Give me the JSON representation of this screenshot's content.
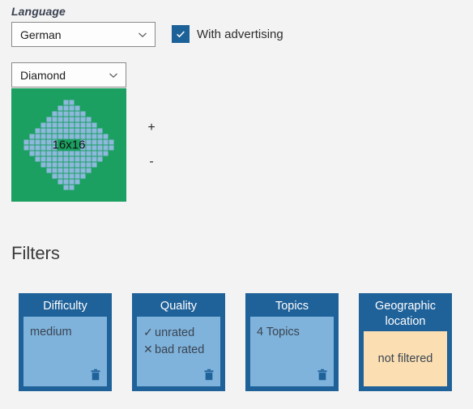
{
  "language_section": {
    "label": "Language",
    "dropdown": {
      "value": "German",
      "icon": "chevron-down-icon"
    },
    "advertising_checkbox": {
      "label": "With advertising",
      "checked": true,
      "icon": "checkmark-icon"
    }
  },
  "shape_section": {
    "dropdown": {
      "value": "Diamond",
      "icon": "chevron-down-icon"
    },
    "preview": {
      "size_label": "16x16",
      "grid_size": 16,
      "background_color": "#1ba062",
      "pixel_color": "#8fb8dd",
      "pattern": [
        "0000000110000000",
        "0000001111000000",
        "0000011111100000",
        "0000111111110000",
        "0001111111111000",
        "0011111111111100",
        "0111111111111110",
        "1111110000111111",
        "1111110000111111",
        "0111111111111110",
        "0011111111111100",
        "0001111111111000",
        "0000111111110000",
        "0000011111100000",
        "0000001111000000",
        "0000000110000000"
      ]
    },
    "zoom_in_label": "+",
    "zoom_out_label": "-"
  },
  "filters": {
    "heading": "Filters",
    "cards": [
      {
        "title": "Difficulty",
        "lines": [
          {
            "mark": "",
            "text": "medium"
          }
        ],
        "body_style": "blue",
        "has_delete": true,
        "delete_icon": "trash-icon"
      },
      {
        "title": "Quality",
        "lines": [
          {
            "mark": "✓",
            "text": "unrated"
          },
          {
            "mark": "✕",
            "text": "bad rated"
          }
        ],
        "body_style": "blue",
        "has_delete": true,
        "delete_icon": "trash-icon"
      },
      {
        "title": "Topics",
        "lines": [
          {
            "mark": "",
            "text": "4 Topics"
          }
        ],
        "body_style": "blue",
        "has_delete": true,
        "delete_icon": "trash-icon"
      },
      {
        "title": "Geographic\nlocation",
        "lines": [
          {
            "mark": "",
            "text": "not filtered"
          }
        ],
        "body_style": "orange",
        "has_delete": false,
        "delete_icon": ""
      }
    ]
  },
  "colors": {
    "card_header": "#1f6199",
    "card_body_blue": "#7fb3dc",
    "card_body_orange": "#fbdfb3",
    "preview_green": "#1ba062",
    "preview_pixel": "#8fb8dd",
    "accent": "#1c6298",
    "page_background": "#f3f3f3"
  }
}
